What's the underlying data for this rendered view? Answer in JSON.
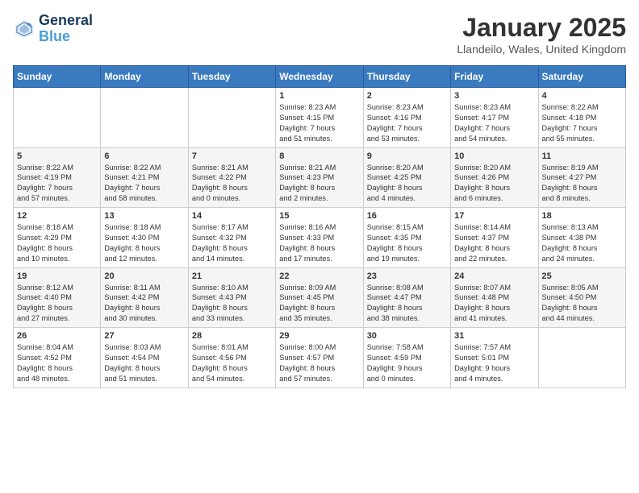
{
  "header": {
    "logo_line1": "General",
    "logo_line2": "Blue",
    "month": "January 2025",
    "location": "Llandeilo, Wales, United Kingdom"
  },
  "weekdays": [
    "Sunday",
    "Monday",
    "Tuesday",
    "Wednesday",
    "Thursday",
    "Friday",
    "Saturday"
  ],
  "weeks": [
    [
      {
        "day": "",
        "info": ""
      },
      {
        "day": "",
        "info": ""
      },
      {
        "day": "",
        "info": ""
      },
      {
        "day": "1",
        "info": "Sunrise: 8:23 AM\nSunset: 4:15 PM\nDaylight: 7 hours\nand 51 minutes."
      },
      {
        "day": "2",
        "info": "Sunrise: 8:23 AM\nSunset: 4:16 PM\nDaylight: 7 hours\nand 53 minutes."
      },
      {
        "day": "3",
        "info": "Sunrise: 8:23 AM\nSunset: 4:17 PM\nDaylight: 7 hours\nand 54 minutes."
      },
      {
        "day": "4",
        "info": "Sunrise: 8:22 AM\nSunset: 4:18 PM\nDaylight: 7 hours\nand 55 minutes."
      }
    ],
    [
      {
        "day": "5",
        "info": "Sunrise: 8:22 AM\nSunset: 4:19 PM\nDaylight: 7 hours\nand 57 minutes."
      },
      {
        "day": "6",
        "info": "Sunrise: 8:22 AM\nSunset: 4:21 PM\nDaylight: 7 hours\nand 58 minutes."
      },
      {
        "day": "7",
        "info": "Sunrise: 8:21 AM\nSunset: 4:22 PM\nDaylight: 8 hours\nand 0 minutes."
      },
      {
        "day": "8",
        "info": "Sunrise: 8:21 AM\nSunset: 4:23 PM\nDaylight: 8 hours\nand 2 minutes."
      },
      {
        "day": "9",
        "info": "Sunrise: 8:20 AM\nSunset: 4:25 PM\nDaylight: 8 hours\nand 4 minutes."
      },
      {
        "day": "10",
        "info": "Sunrise: 8:20 AM\nSunset: 4:26 PM\nDaylight: 8 hours\nand 6 minutes."
      },
      {
        "day": "11",
        "info": "Sunrise: 8:19 AM\nSunset: 4:27 PM\nDaylight: 8 hours\nand 8 minutes."
      }
    ],
    [
      {
        "day": "12",
        "info": "Sunrise: 8:18 AM\nSunset: 4:29 PM\nDaylight: 8 hours\nand 10 minutes."
      },
      {
        "day": "13",
        "info": "Sunrise: 8:18 AM\nSunset: 4:30 PM\nDaylight: 8 hours\nand 12 minutes."
      },
      {
        "day": "14",
        "info": "Sunrise: 8:17 AM\nSunset: 4:32 PM\nDaylight: 8 hours\nand 14 minutes."
      },
      {
        "day": "15",
        "info": "Sunrise: 8:16 AM\nSunset: 4:33 PM\nDaylight: 8 hours\nand 17 minutes."
      },
      {
        "day": "16",
        "info": "Sunrise: 8:15 AM\nSunset: 4:35 PM\nDaylight: 8 hours\nand 19 minutes."
      },
      {
        "day": "17",
        "info": "Sunrise: 8:14 AM\nSunset: 4:37 PM\nDaylight: 8 hours\nand 22 minutes."
      },
      {
        "day": "18",
        "info": "Sunrise: 8:13 AM\nSunset: 4:38 PM\nDaylight: 8 hours\nand 24 minutes."
      }
    ],
    [
      {
        "day": "19",
        "info": "Sunrise: 8:12 AM\nSunset: 4:40 PM\nDaylight: 8 hours\nand 27 minutes."
      },
      {
        "day": "20",
        "info": "Sunrise: 8:11 AM\nSunset: 4:42 PM\nDaylight: 8 hours\nand 30 minutes."
      },
      {
        "day": "21",
        "info": "Sunrise: 8:10 AM\nSunset: 4:43 PM\nDaylight: 8 hours\nand 33 minutes."
      },
      {
        "day": "22",
        "info": "Sunrise: 8:09 AM\nSunset: 4:45 PM\nDaylight: 8 hours\nand 35 minutes."
      },
      {
        "day": "23",
        "info": "Sunrise: 8:08 AM\nSunset: 4:47 PM\nDaylight: 8 hours\nand 38 minutes."
      },
      {
        "day": "24",
        "info": "Sunrise: 8:07 AM\nSunset: 4:48 PM\nDaylight: 8 hours\nand 41 minutes."
      },
      {
        "day": "25",
        "info": "Sunrise: 8:05 AM\nSunset: 4:50 PM\nDaylight: 8 hours\nand 44 minutes."
      }
    ],
    [
      {
        "day": "26",
        "info": "Sunrise: 8:04 AM\nSunset: 4:52 PM\nDaylight: 8 hours\nand 48 minutes."
      },
      {
        "day": "27",
        "info": "Sunrise: 8:03 AM\nSunset: 4:54 PM\nDaylight: 8 hours\nand 51 minutes."
      },
      {
        "day": "28",
        "info": "Sunrise: 8:01 AM\nSunset: 4:56 PM\nDaylight: 8 hours\nand 54 minutes."
      },
      {
        "day": "29",
        "info": "Sunrise: 8:00 AM\nSunset: 4:57 PM\nDaylight: 8 hours\nand 57 minutes."
      },
      {
        "day": "30",
        "info": "Sunrise: 7:58 AM\nSunset: 4:59 PM\nDaylight: 9 hours\nand 0 minutes."
      },
      {
        "day": "31",
        "info": "Sunrise: 7:57 AM\nSunset: 5:01 PM\nDaylight: 9 hours\nand 4 minutes."
      },
      {
        "day": "",
        "info": ""
      }
    ]
  ]
}
